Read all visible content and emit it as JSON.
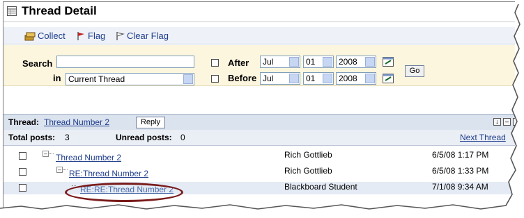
{
  "header": {
    "title": "Thread Detail"
  },
  "toolbar": {
    "collect": "Collect",
    "flag": "Flag",
    "clear_flag": "Clear Flag"
  },
  "search": {
    "search_label": "Search",
    "in_label": "in",
    "scope_value": "Current Thread",
    "after_label": "After",
    "before_label": "Before",
    "after_month": "Jul",
    "after_day": "01",
    "after_year": "2008",
    "before_month": "Jul",
    "before_day": "01",
    "before_year": "2008",
    "go_label": "Go"
  },
  "thread": {
    "label": "Thread:",
    "name": "Thread Number 2",
    "reply_label": "Reply",
    "total_label": "Total posts:",
    "total_value": "3",
    "unread_label": "Unread posts:",
    "unread_value": "0",
    "next_label": "Next Thread"
  },
  "posts": [
    {
      "title": "Thread Number 2",
      "author": "Rich Gottlieb",
      "date": "6/5/08 1:17 PM"
    },
    {
      "title": "RE:Thread Number 2",
      "author": "Rich Gottlieb",
      "date": "6/5/08 1:33 PM"
    },
    {
      "title": "RE:RE:Thread Number 2",
      "author": "Blackboard Student",
      "date": "7/1/08 9:34 AM"
    }
  ],
  "colors": {
    "link": "#1f3d8c",
    "search_bg": "#fdf6df",
    "highlight_row": "#e4ebf5",
    "annotation": "#7a1b1b"
  }
}
